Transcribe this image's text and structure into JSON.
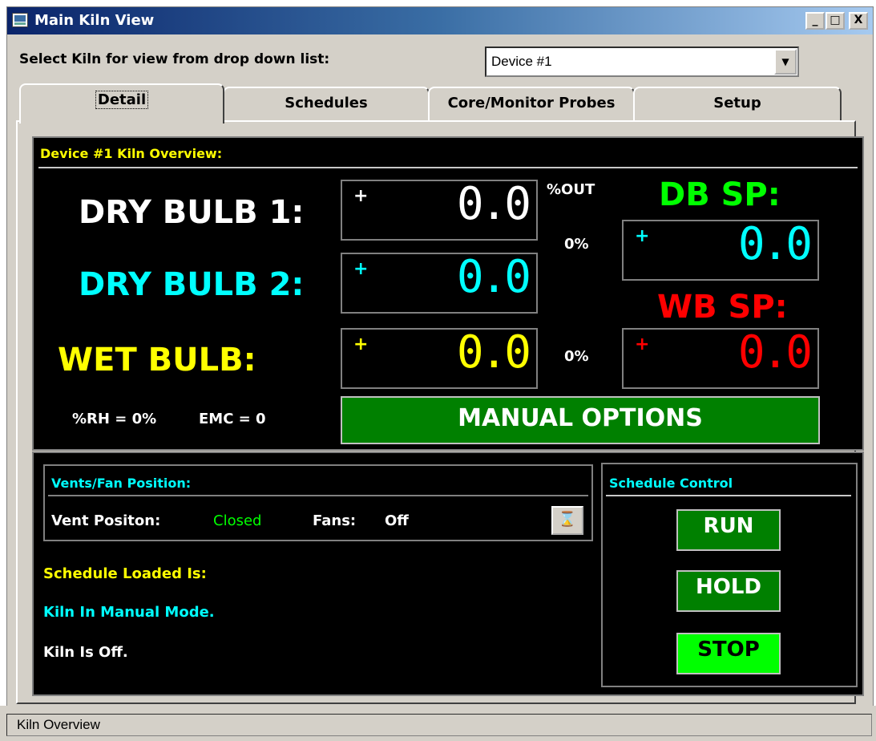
{
  "window": {
    "title": "Main Kiln View",
    "minimize": "_",
    "maximize": "□",
    "close": "X"
  },
  "selector": {
    "label": "Select Kiln for view from drop down list:",
    "value": "Device #1",
    "arrow": "▼"
  },
  "tabs": [
    {
      "label": "Detail",
      "active": true
    },
    {
      "label": "Schedules"
    },
    {
      "label": "Core/Monitor Probes"
    },
    {
      "label": "Setup"
    }
  ],
  "overview": {
    "title": "Device #1 Kiln Overview:",
    "dry_bulb_1": {
      "label": "DRY BULB 1:",
      "sign": "+",
      "value": "0.0",
      "color": "#ffffff"
    },
    "dry_bulb_2": {
      "label": "DRY BULB 2:",
      "sign": "+",
      "value": "0.0",
      "color": "#00ffff"
    },
    "wet_bulb": {
      "label": "WET BULB:",
      "sign": "+",
      "value": "0.0",
      "color": "#ffff00"
    },
    "out_header": "%OUT",
    "db_out": "0%",
    "wb_out": "0%",
    "db_sp": {
      "label": "DB SP:",
      "sign": "+",
      "value": "0.0",
      "color": "#00ff00",
      "display_color": "#00ffff"
    },
    "wb_sp": {
      "label": "WB SP:",
      "sign": "+",
      "value": "0.0",
      "color": "#ff0000"
    },
    "rh": "%RH = 0%",
    "emc": "EMC = 0",
    "manual_button": "MANUAL OPTIONS"
  },
  "vents": {
    "title": "Vents/Fan Position:",
    "vent_label": "Vent Positon:",
    "vent_value": "Closed",
    "fans_label": "Fans:",
    "fans_value": "Off",
    "hourglass_icon": "⌛"
  },
  "status_lines": {
    "schedule_loaded": "Schedule Loaded Is:",
    "mode": "Kiln In Manual Mode.",
    "state": "Kiln Is Off."
  },
  "schedule_control": {
    "title": "Schedule Control",
    "run": "RUN",
    "hold": "HOLD",
    "stop": "STOP"
  },
  "statusbar": {
    "text": "Kiln Overview"
  }
}
